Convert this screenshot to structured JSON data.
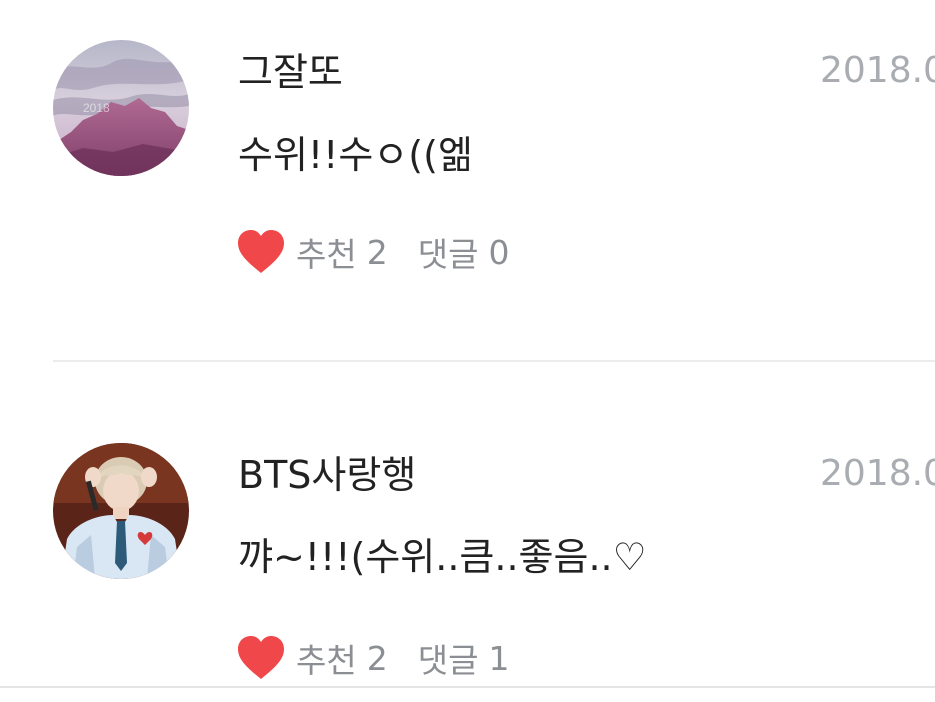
{
  "comments": [
    {
      "author": "그잘또",
      "date": "2018.0",
      "text": "수위!!수ㅇ((엚",
      "recommend_label": "추천",
      "recommend_count": "2",
      "reply_label": "댓글",
      "reply_count": "0",
      "avatar_icon": "mountain-photo-avatar",
      "avatar_watermark": "2018"
    },
    {
      "author": "BTS사랑행",
      "date": "2018.0",
      "text": "꺄~!!!(수위..큼..좋음..♡",
      "recommend_label": "추천",
      "recommend_count": "2",
      "reply_label": "댓글",
      "reply_count": "1",
      "avatar_icon": "person-photo-avatar"
    }
  ],
  "colors": {
    "heart": "#f0484a",
    "meta_text": "#8b8f94",
    "date_text": "#a9adb2",
    "body_text": "#222222",
    "divider": "#ececec"
  }
}
